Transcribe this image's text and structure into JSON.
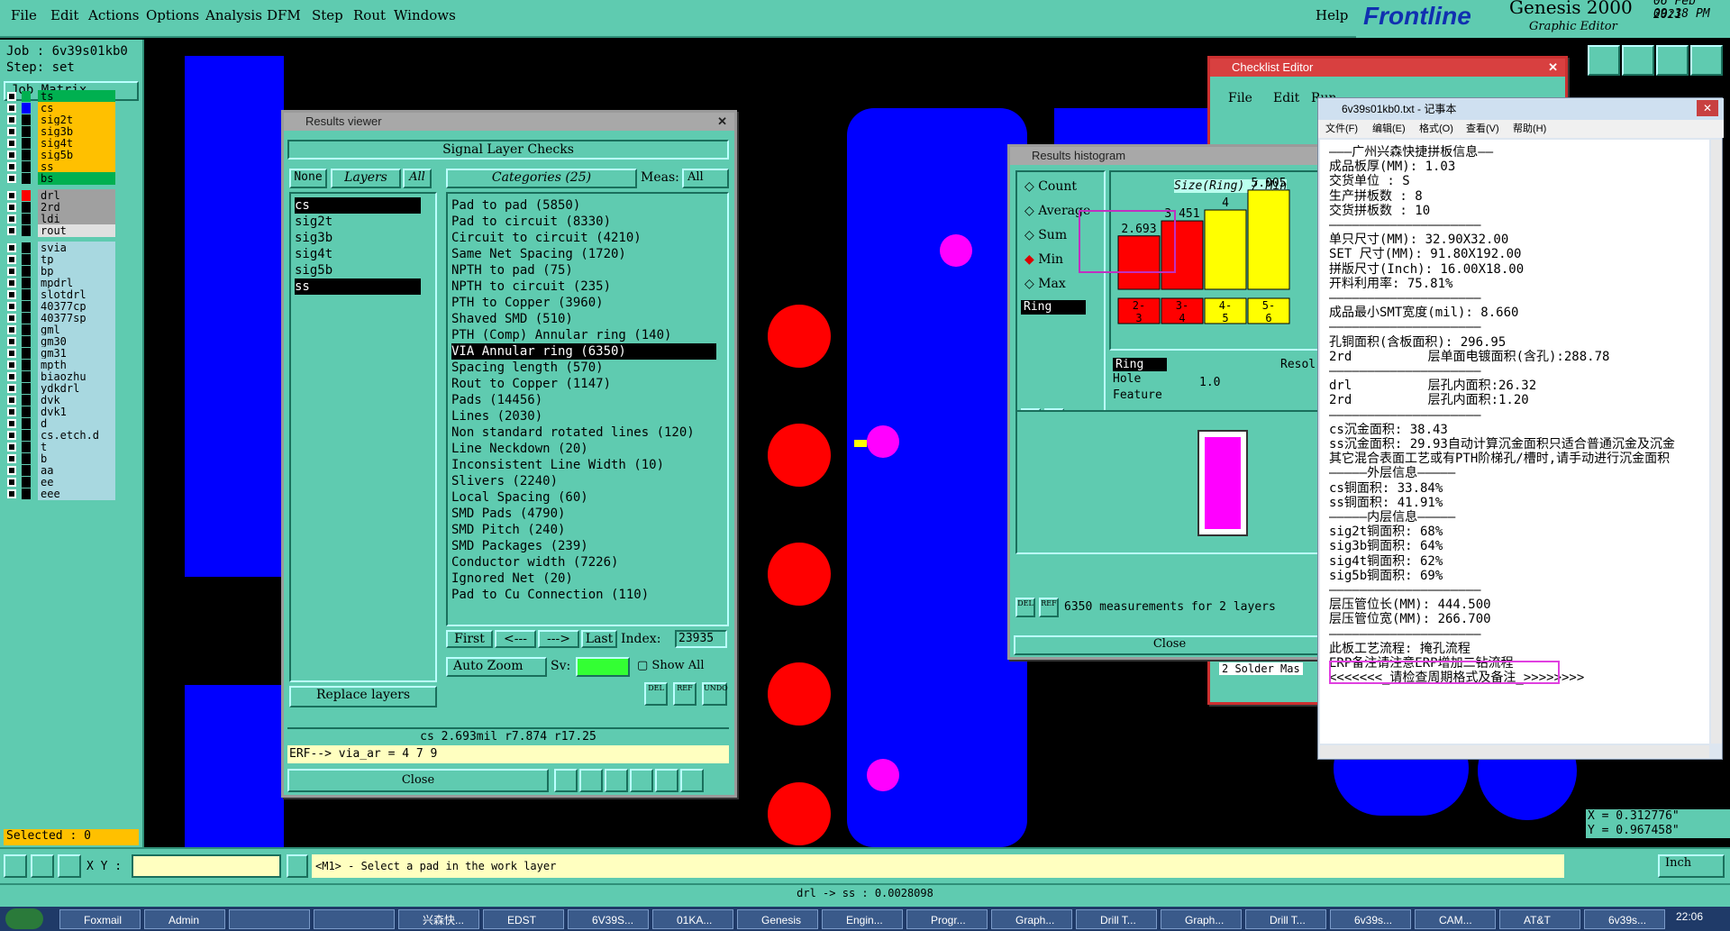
{
  "menu": {
    "file": "File",
    "edit": "Edit",
    "actions": "Actions",
    "options": "Options",
    "analysis": "Analysis",
    "dfm": "DFM",
    "step": "Step",
    "rout": "Rout",
    "windows": "Windows",
    "help": "Help"
  },
  "brand": {
    "logo": "Frontline",
    "product": "Genesis 2000",
    "subtitle": "Graphic Editor",
    "date": "06 Feb 2021",
    "time": "09:38 PM"
  },
  "left": {
    "job": "Job : 6v39s01kb0",
    "step": "Step: set",
    "job_matrix": "Job Matrix ...",
    "layers": [
      {
        "name": "ts",
        "color": "#00b050",
        "sw": "#00b050"
      },
      {
        "name": "cs",
        "color": "#ffc000",
        "sw": "#0000ff",
        "sel": true
      },
      {
        "name": "sig2t",
        "color": "#ffc000",
        "sw": "#000"
      },
      {
        "name": "sig3b",
        "color": "#ffc000",
        "sw": "#000"
      },
      {
        "name": "sig4t",
        "color": "#ffc000",
        "sw": "#000"
      },
      {
        "name": "sig5b",
        "color": "#ffc000",
        "sw": "#000"
      },
      {
        "name": "ss",
        "color": "#ffc000",
        "sw": "#000"
      },
      {
        "name": "bs",
        "color": "#00b050",
        "sw": "#000"
      },
      {
        "name": "drl",
        "color": "#a0a0a0",
        "sw": "#ff0000"
      },
      {
        "name": "2rd",
        "color": "#a0a0a0",
        "sw": "#000"
      },
      {
        "name": "ldi",
        "color": "#a0a0a0",
        "sw": "#000"
      },
      {
        "name": "rout",
        "color": "#e0e0e0",
        "sw": "#000"
      },
      {
        "name": "svia",
        "color": "#a8d8e0",
        "sw": "#000"
      },
      {
        "name": "tp",
        "color": "#a8d8e0",
        "sw": "#000"
      },
      {
        "name": "bp",
        "color": "#a8d8e0",
        "sw": "#000"
      },
      {
        "name": "mpdrl",
        "color": "#a8d8e0",
        "sw": "#000"
      },
      {
        "name": "slotdrl",
        "color": "#a8d8e0",
        "sw": "#000"
      },
      {
        "name": "40377cp",
        "color": "#a8d8e0",
        "sw": "#000"
      },
      {
        "name": "40377sp",
        "color": "#a8d8e0",
        "sw": "#000"
      },
      {
        "name": "gml",
        "color": "#a8d8e0",
        "sw": "#000"
      },
      {
        "name": "gm30",
        "color": "#a8d8e0",
        "sw": "#000"
      },
      {
        "name": "gm31",
        "color": "#a8d8e0",
        "sw": "#000"
      },
      {
        "name": "mpth",
        "color": "#a8d8e0",
        "sw": "#000"
      },
      {
        "name": "biaozhu",
        "color": "#a8d8e0",
        "sw": "#000"
      },
      {
        "name": "ydkdrl",
        "color": "#a8d8e0",
        "sw": "#000"
      },
      {
        "name": "dvk",
        "color": "#a8d8e0",
        "sw": "#000"
      },
      {
        "name": "dvk1",
        "color": "#a8d8e0",
        "sw": "#000"
      },
      {
        "name": "d",
        "color": "#a8d8e0",
        "sw": "#000"
      },
      {
        "name": "cs.etch.d",
        "color": "#a8d8e0",
        "sw": "#000"
      },
      {
        "name": "t",
        "color": "#a8d8e0",
        "sw": "#000"
      },
      {
        "name": "b",
        "color": "#a8d8e0",
        "sw": "#000"
      },
      {
        "name": "aa",
        "color": "#a8d8e0",
        "sw": "#000"
      },
      {
        "name": "ee",
        "color": "#a8d8e0",
        "sw": "#000"
      },
      {
        "name": "eee",
        "color": "#a8d8e0",
        "sw": "#000"
      }
    ],
    "selected": "Selected : 0"
  },
  "results": {
    "title": "Results viewer",
    "header": "Signal Layer Checks",
    "none": "None",
    "layers": "Layers",
    "all": "All",
    "categories": "Categories (25)",
    "meas": "Meas:",
    "meas_val": "All",
    "layer_list": [
      "cs",
      "sig2t",
      "sig3b",
      "sig4t",
      "sig5b",
      "ss"
    ],
    "cat_list": [
      "Pad to pad (5850)",
      "Pad to circuit (8330)",
      "Circuit to circuit (4210)",
      "Same Net Spacing (1720)",
      "NPTH to pad (75)",
      "NPTH to circuit (235)",
      "PTH to Copper (3960)",
      "Shaved SMD (510)",
      "PTH (Comp) Annular ring (140)",
      "VIA Annular ring (6350)",
      "Spacing length (570)",
      "Rout to Copper (1147)",
      "Pads (14456)",
      "Lines (2030)",
      "Non standard rotated lines (120)",
      "Line Neckdown (20)",
      "Inconsistent Line Width (10)",
      "Slivers (2240)",
      "Local Spacing (60)",
      "SMD Pads (4790)",
      "SMD Pitch (240)",
      "SMD Packages (239)",
      "Conductor width (7226)",
      "Ignored Net (20)",
      "Pad to Cu Connection (110)"
    ],
    "first": "First",
    "prev": "<---",
    "next": "--->",
    "last": "Last",
    "index_label": "Index:",
    "index_val": "23935",
    "auto_zoom": "Auto Zoom",
    "sv": "Sv:",
    "show_all": "Show All",
    "replace": "Replace layers",
    "del": "DEL",
    "ref": "REF",
    "undo": "UNDO",
    "info": "cs 2.693mil   r7.874   r17.25",
    "erf": "ERF--> via_ar = 4 7 9",
    "close": "Close"
  },
  "hist": {
    "title": "Results histogram",
    "count": "Count",
    "average": "Average",
    "sum": "Sum",
    "min": "Min",
    "max": "Max",
    "chart_title": "Size(Ring) / Min",
    "ring": "Ring",
    "hole": "Hole",
    "feature": "Feature",
    "resol": "Resol",
    "resol_val": "1.0",
    "summary": "6350 measurements for 2 layers",
    "close": "Close",
    "del": "DEL",
    "ref": "REF"
  },
  "chart_data": {
    "type": "bar",
    "title": "Size(Ring) / Min",
    "categories": [
      "2-3",
      "3-4",
      "4-5",
      "5-6"
    ],
    "values": [
      2.693,
      3.451,
      4,
      5.005
    ],
    "colors": [
      "#ff0000",
      "#ff0000",
      "#ffff00",
      "#ffff00"
    ]
  },
  "checklist": {
    "title": "Checklist Editor",
    "file": "File",
    "edit": "Edit",
    "run": "Run",
    "item": "2 Solder Mas"
  },
  "notepad": {
    "title": "6v39s01kb0.txt - 记事本",
    "menu": [
      "文件(F)",
      "编辑(E)",
      "格式(O)",
      "查看(V)",
      "帮助(H)"
    ],
    "lines": [
      "———广州兴森快捷拼板信息——",
      "成品板厚(MM): 1.03",
      "交货单位 : S",
      "生产拼板数 : 8",
      "交货拼板数 : 10",
      "————————————————————",
      "单只尺寸(MM): 32.90X32.00",
      "SET 尺寸(MM): 91.80X192.00",
      "拼版尺寸(Inch): 16.00X18.00",
      "开料利用率: 75.81%",
      "————————————————————",
      "成品最小SMT宽度(mil): 8.660",
      "————————————————————",
      "孔铜面积(含板面积): 296.95",
      "2rd          层单面电镀面积(含孔):288.78",
      "————————————————————",
      "drl          层孔内面积:26.32",
      "2rd          层孔内面积:1.20",
      "————————————————————",
      "cs沉金面积: 38.43",
      "ss沉金面积: 29.93自动计算沉金面积只适合普通沉金及沉金",
      "其它混合表面工艺或有PTH阶梯孔/槽时,请手动进行沉金面积",
      "—————外层信息—————",
      "cs铜面积: 33.84%",
      "ss铜面积: 41.91%",
      "—————内层信息—————",
      "sig2t铜面积: 68%",
      "sig3b铜面积: 64%",
      "sig4t铜面积: 62%",
      "sig5b铜面积: 69%",
      "————————————————————",
      "层压管位长(MM): 444.500",
      "层压管位宽(MM): 266.700",
      "————————————————————",
      "此板工艺流程: 掩孔流程",
      "ERP备注请注意ERP增加二钻流程",
      "<<<<<<<_请检查周期格式及备注_>>>>>>>>"
    ]
  },
  "coords": {
    "x": "X = 0.312776\"",
    "y": "Y = 0.967458\""
  },
  "status": {
    "xy_label": "X Y :",
    "prompt": "<M1> - Select a pad in the work layer",
    "units": "Inch",
    "bottom": "drl -> ss : 0.0028098"
  },
  "taskbar": [
    "Foxmail",
    "Admin",
    "",
    "",
    "兴森快...",
    "EDST",
    "6V39S...",
    "01KA...",
    "Genesis",
    "Engin...",
    "Progr...",
    "Graph...",
    "Drill T...",
    "Graph...",
    "Drill T...",
    "6v39s...",
    "CAM...",
    "AT&T",
    "6v39s..."
  ],
  "clock": "22:06"
}
